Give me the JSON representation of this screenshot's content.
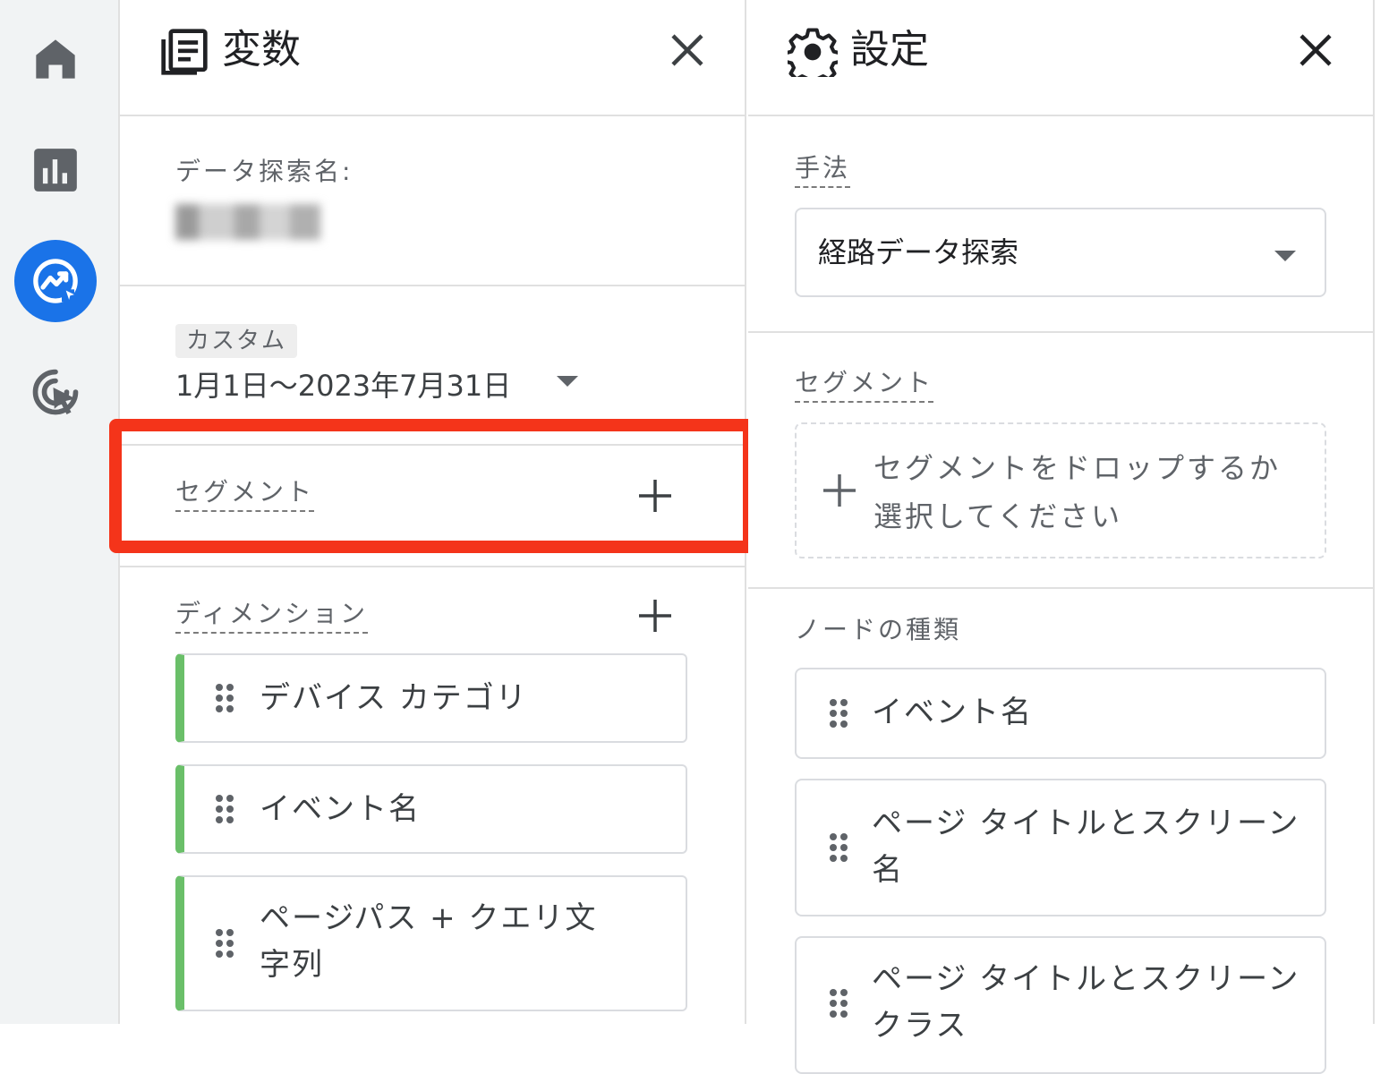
{
  "nav": {
    "items": [
      {
        "icon": "home-icon"
      },
      {
        "icon": "reports-icon"
      },
      {
        "icon": "explore-icon",
        "active": true
      },
      {
        "icon": "advertising-icon"
      }
    ],
    "accent": "#1a73e8"
  },
  "variables": {
    "title": "変数",
    "exploration_name_label": "データ探索名:",
    "date_chip": "カスタム",
    "date_range": "1月1日～2023年7月31日",
    "segments_label": "セグメント",
    "dimensions_label": "ディメンション",
    "dimensions": [
      {
        "line1": "デバイス カテゴリ",
        "line2": ""
      },
      {
        "line1": "イベント名",
        "line2": ""
      },
      {
        "line1": "ページパス + クエリ文",
        "line2": "字列"
      }
    ],
    "dimension_accent": "#6abf69"
  },
  "settings": {
    "title": "設定",
    "technique_label": "手法",
    "technique_value": "経路データ探索",
    "segments_label": "セグメント",
    "segment_drop_line1": "セグメントをドロップするか",
    "segment_drop_line2": "選択してください",
    "node_type_label": "ノードの種類",
    "nodes": [
      {
        "line1": "イベント名",
        "line2": ""
      },
      {
        "line1": "ページ タイトルとスクリーン",
        "line2": "名"
      },
      {
        "line1": "ページ タイトルとスクリーン",
        "line2": "クラス"
      }
    ]
  },
  "highlight_color": "#f4341a"
}
